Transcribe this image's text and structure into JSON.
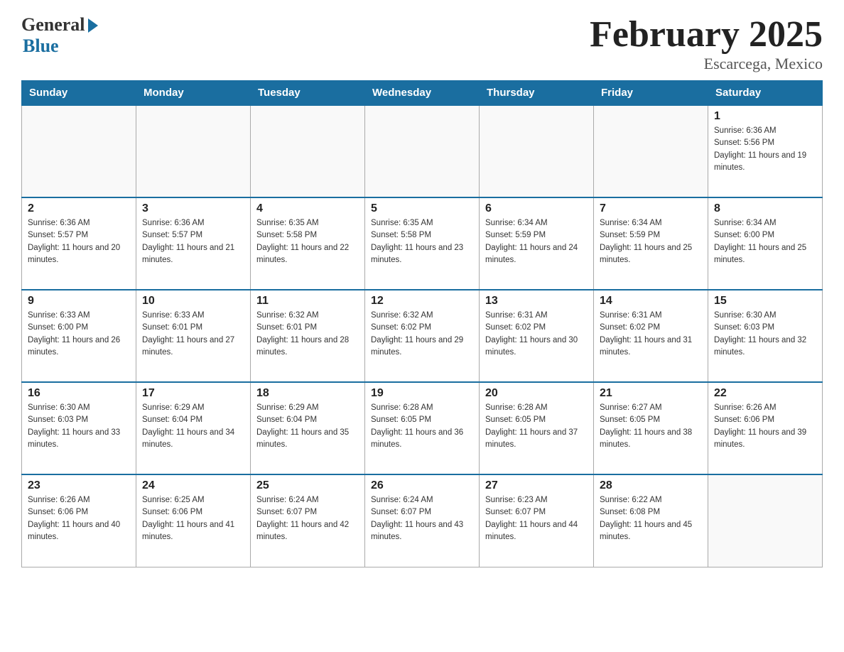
{
  "logo": {
    "general": "General",
    "blue": "Blue"
  },
  "header": {
    "title": "February 2025",
    "location": "Escarcega, Mexico"
  },
  "days_of_week": [
    "Sunday",
    "Monday",
    "Tuesday",
    "Wednesday",
    "Thursday",
    "Friday",
    "Saturday"
  ],
  "weeks": [
    [
      {
        "day": "",
        "sunrise": "",
        "sunset": "",
        "daylight": ""
      },
      {
        "day": "",
        "sunrise": "",
        "sunset": "",
        "daylight": ""
      },
      {
        "day": "",
        "sunrise": "",
        "sunset": "",
        "daylight": ""
      },
      {
        "day": "",
        "sunrise": "",
        "sunset": "",
        "daylight": ""
      },
      {
        "day": "",
        "sunrise": "",
        "sunset": "",
        "daylight": ""
      },
      {
        "day": "",
        "sunrise": "",
        "sunset": "",
        "daylight": ""
      },
      {
        "day": "1",
        "sunrise": "Sunrise: 6:36 AM",
        "sunset": "Sunset: 5:56 PM",
        "daylight": "Daylight: 11 hours and 19 minutes."
      }
    ],
    [
      {
        "day": "2",
        "sunrise": "Sunrise: 6:36 AM",
        "sunset": "Sunset: 5:57 PM",
        "daylight": "Daylight: 11 hours and 20 minutes."
      },
      {
        "day": "3",
        "sunrise": "Sunrise: 6:36 AM",
        "sunset": "Sunset: 5:57 PM",
        "daylight": "Daylight: 11 hours and 21 minutes."
      },
      {
        "day": "4",
        "sunrise": "Sunrise: 6:35 AM",
        "sunset": "Sunset: 5:58 PM",
        "daylight": "Daylight: 11 hours and 22 minutes."
      },
      {
        "day": "5",
        "sunrise": "Sunrise: 6:35 AM",
        "sunset": "Sunset: 5:58 PM",
        "daylight": "Daylight: 11 hours and 23 minutes."
      },
      {
        "day": "6",
        "sunrise": "Sunrise: 6:34 AM",
        "sunset": "Sunset: 5:59 PM",
        "daylight": "Daylight: 11 hours and 24 minutes."
      },
      {
        "day": "7",
        "sunrise": "Sunrise: 6:34 AM",
        "sunset": "Sunset: 5:59 PM",
        "daylight": "Daylight: 11 hours and 25 minutes."
      },
      {
        "day": "8",
        "sunrise": "Sunrise: 6:34 AM",
        "sunset": "Sunset: 6:00 PM",
        "daylight": "Daylight: 11 hours and 25 minutes."
      }
    ],
    [
      {
        "day": "9",
        "sunrise": "Sunrise: 6:33 AM",
        "sunset": "Sunset: 6:00 PM",
        "daylight": "Daylight: 11 hours and 26 minutes."
      },
      {
        "day": "10",
        "sunrise": "Sunrise: 6:33 AM",
        "sunset": "Sunset: 6:01 PM",
        "daylight": "Daylight: 11 hours and 27 minutes."
      },
      {
        "day": "11",
        "sunrise": "Sunrise: 6:32 AM",
        "sunset": "Sunset: 6:01 PM",
        "daylight": "Daylight: 11 hours and 28 minutes."
      },
      {
        "day": "12",
        "sunrise": "Sunrise: 6:32 AM",
        "sunset": "Sunset: 6:02 PM",
        "daylight": "Daylight: 11 hours and 29 minutes."
      },
      {
        "day": "13",
        "sunrise": "Sunrise: 6:31 AM",
        "sunset": "Sunset: 6:02 PM",
        "daylight": "Daylight: 11 hours and 30 minutes."
      },
      {
        "day": "14",
        "sunrise": "Sunrise: 6:31 AM",
        "sunset": "Sunset: 6:02 PM",
        "daylight": "Daylight: 11 hours and 31 minutes."
      },
      {
        "day": "15",
        "sunrise": "Sunrise: 6:30 AM",
        "sunset": "Sunset: 6:03 PM",
        "daylight": "Daylight: 11 hours and 32 minutes."
      }
    ],
    [
      {
        "day": "16",
        "sunrise": "Sunrise: 6:30 AM",
        "sunset": "Sunset: 6:03 PM",
        "daylight": "Daylight: 11 hours and 33 minutes."
      },
      {
        "day": "17",
        "sunrise": "Sunrise: 6:29 AM",
        "sunset": "Sunset: 6:04 PM",
        "daylight": "Daylight: 11 hours and 34 minutes."
      },
      {
        "day": "18",
        "sunrise": "Sunrise: 6:29 AM",
        "sunset": "Sunset: 6:04 PM",
        "daylight": "Daylight: 11 hours and 35 minutes."
      },
      {
        "day": "19",
        "sunrise": "Sunrise: 6:28 AM",
        "sunset": "Sunset: 6:05 PM",
        "daylight": "Daylight: 11 hours and 36 minutes."
      },
      {
        "day": "20",
        "sunrise": "Sunrise: 6:28 AM",
        "sunset": "Sunset: 6:05 PM",
        "daylight": "Daylight: 11 hours and 37 minutes."
      },
      {
        "day": "21",
        "sunrise": "Sunrise: 6:27 AM",
        "sunset": "Sunset: 6:05 PM",
        "daylight": "Daylight: 11 hours and 38 minutes."
      },
      {
        "day": "22",
        "sunrise": "Sunrise: 6:26 AM",
        "sunset": "Sunset: 6:06 PM",
        "daylight": "Daylight: 11 hours and 39 minutes."
      }
    ],
    [
      {
        "day": "23",
        "sunrise": "Sunrise: 6:26 AM",
        "sunset": "Sunset: 6:06 PM",
        "daylight": "Daylight: 11 hours and 40 minutes."
      },
      {
        "day": "24",
        "sunrise": "Sunrise: 6:25 AM",
        "sunset": "Sunset: 6:06 PM",
        "daylight": "Daylight: 11 hours and 41 minutes."
      },
      {
        "day": "25",
        "sunrise": "Sunrise: 6:24 AM",
        "sunset": "Sunset: 6:07 PM",
        "daylight": "Daylight: 11 hours and 42 minutes."
      },
      {
        "day": "26",
        "sunrise": "Sunrise: 6:24 AM",
        "sunset": "Sunset: 6:07 PM",
        "daylight": "Daylight: 11 hours and 43 minutes."
      },
      {
        "day": "27",
        "sunrise": "Sunrise: 6:23 AM",
        "sunset": "Sunset: 6:07 PM",
        "daylight": "Daylight: 11 hours and 44 minutes."
      },
      {
        "day": "28",
        "sunrise": "Sunrise: 6:22 AM",
        "sunset": "Sunset: 6:08 PM",
        "daylight": "Daylight: 11 hours and 45 minutes."
      },
      {
        "day": "",
        "sunrise": "",
        "sunset": "",
        "daylight": ""
      }
    ]
  ]
}
